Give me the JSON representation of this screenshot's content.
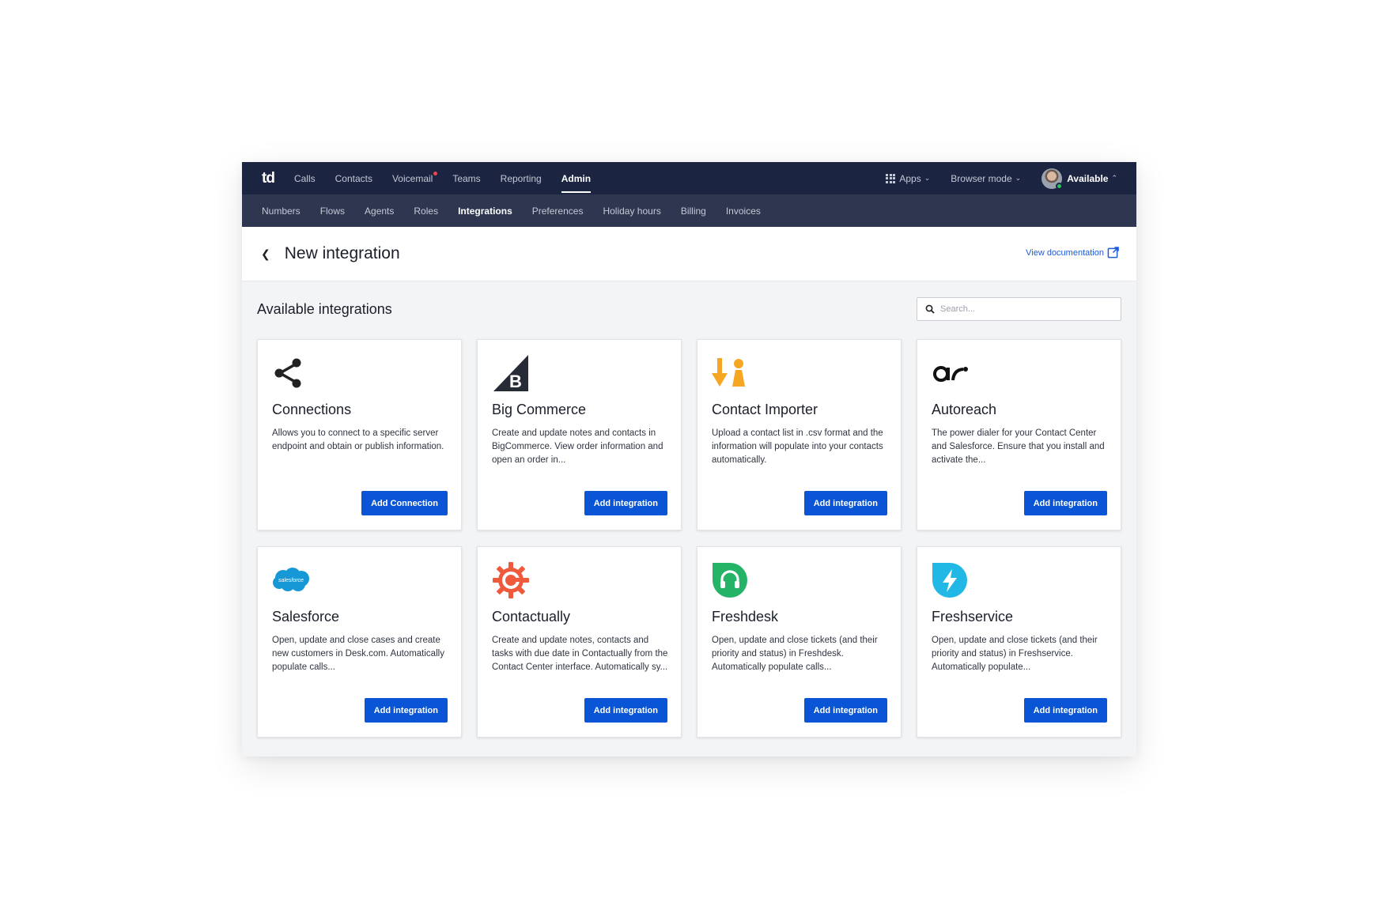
{
  "topnav": {
    "logo": "td",
    "items": [
      "Calls",
      "Contacts",
      "Voicemail",
      "Teams",
      "Reporting",
      "Admin"
    ],
    "active": "Admin",
    "apps_label": "Apps",
    "browser_mode_label": "Browser mode",
    "status_label": "Available"
  },
  "subnav": {
    "items": [
      "Numbers",
      "Flows",
      "Agents",
      "Roles",
      "Integrations",
      "Preferences",
      "Holiday hours",
      "Billing",
      "Invoices"
    ],
    "active": "Integrations"
  },
  "header": {
    "title": "New integration",
    "doc_link": "View documentation"
  },
  "section": {
    "title": "Available integrations",
    "search_placeholder": "Search..."
  },
  "cards": [
    {
      "title": "Connections",
      "description": "Allows you to connect to a specific server endpoint and obtain or publish information.",
      "button": "Add Connection",
      "icon": "share-icon"
    },
    {
      "title": "Big Commerce",
      "description": "Create and update notes and contacts in BigCommerce. View order information and open an order in...",
      "button": "Add integration",
      "icon": "bigcommerce-logo"
    },
    {
      "title": "Contact Importer",
      "description": "Upload a contact list in .csv format and the information will populate into your contacts automatically.",
      "button": "Add integration",
      "icon": "contact-importer-icon"
    },
    {
      "title": "Autoreach",
      "description": "The power dialer for your Contact Center and Salesforce. Ensure that you install and activate the...",
      "button": "Add integration",
      "icon": "autoreach-logo"
    },
    {
      "title": "Salesforce",
      "description": "Open, update and close cases and create new customers in Desk.com. Automatically populate calls...",
      "button": "Add integration",
      "icon": "salesforce-logo"
    },
    {
      "title": "Contactually",
      "description": "Create and update notes, contacts and tasks with due date in Contactually from the Contact Center interface. Automatically sy...",
      "button": "Add integration",
      "icon": "contactually-logo"
    },
    {
      "title": "Freshdesk",
      "description": "Open, update and close tickets (and their priority and status) in Freshdesk. Automatically populate calls...",
      "button": "Add integration",
      "icon": "freshdesk-logo"
    },
    {
      "title": "Freshservice",
      "description": "Open, update and close tickets (and their priority and status) in Freshservice. Automatically populate...",
      "button": "Add integration",
      "icon": "freshservice-logo"
    }
  ],
  "logo_text": {
    "salesforce": "salesforce"
  },
  "colors": {
    "topnav_bg": "#1b2441",
    "subnav_bg": "#2e3650",
    "primary_button": "#0a55d6",
    "link": "#1d5bd8"
  }
}
